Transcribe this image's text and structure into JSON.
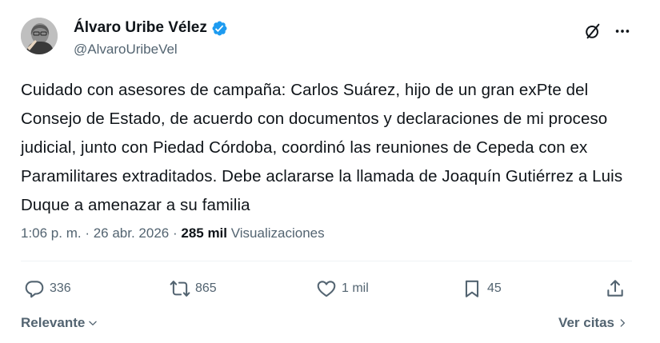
{
  "author": {
    "name": "Álvaro Uribe Vélez",
    "handle": "@AlvaroUribeVel"
  },
  "tweet": {
    "text": "Cuidado con asesores de campaña: Carlos Suárez, hijo de un gran exPte del Consejo de Estado, de acuerdo con documentos y declaraciones de mi proceso judicial, junto con Piedad Córdoba, coordinó las reuniones de Cepeda con ex Paramilitares extraditados. Debe aclararse la llamada de Joaquín Gutiérrez a Luis Duque a amenazar a su familia"
  },
  "meta": {
    "time": "1:06 p. m.",
    "separator": " · ",
    "date": "26 abr. 2026",
    "views_count": "285 mil",
    "views_label": "Visualizaciones"
  },
  "actions": {
    "replies": "336",
    "reposts": "865",
    "likes": "1 mil",
    "bookmarks": "45"
  },
  "footer": {
    "sort_label": "Relevante",
    "quotes_label": "Ver citas"
  },
  "colors": {
    "text": "#0f1419",
    "secondary": "#536471",
    "verified": "#1d9bf0",
    "divider": "#eff3f4"
  },
  "icons": [
    "verified-badge-icon",
    "grok-icon",
    "more-icon",
    "reply-icon",
    "repost-icon",
    "like-icon",
    "bookmark-icon",
    "share-icon",
    "chevron-down-icon",
    "chevron-right-icon"
  ]
}
